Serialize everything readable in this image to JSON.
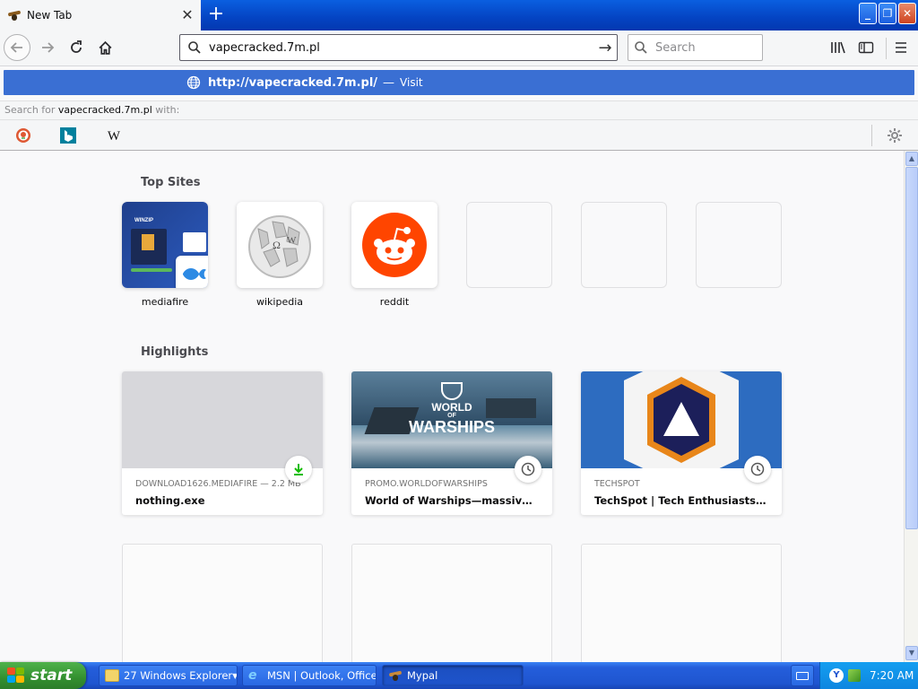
{
  "browser": {
    "tab_title": "New Tab",
    "url_value": "vapecracked.7m.pl",
    "search_placeholder": "Search"
  },
  "suggestion": {
    "url": "http://vapecracked.7m.pl/",
    "separator": "—",
    "action": "Visit"
  },
  "search_for": {
    "prefix": "Search for",
    "query": "vapecracked.7m.pl",
    "suffix": "with:"
  },
  "search_engines": [
    "duckduckgo-icon",
    "bing-icon",
    "wikipedia-icon"
  ],
  "top_sites": {
    "title": "Top Sites",
    "items": [
      {
        "label": "mediafire"
      },
      {
        "label": "wikipedia"
      },
      {
        "label": "reddit"
      },
      {
        "label": ""
      },
      {
        "label": ""
      },
      {
        "label": ""
      }
    ],
    "mediafire_preview_text": "WINZIP"
  },
  "highlights": {
    "title": "Highlights",
    "items": [
      {
        "source": "DOWNLOAD1626.MEDIAFIRE — 2.2 MB",
        "title": "nothing.exe",
        "badge": "download-icon"
      },
      {
        "source": "PROMO.WORLDOFWARSHIPS",
        "title": "World of Warships—massive naval battles",
        "badge": "clock-icon",
        "logo_line1": "WORLD",
        "logo_line2": "OF",
        "logo_line3": "WARSHIPS"
      },
      {
        "source": "TECHSPOT",
        "title": "TechSpot | Tech Enthusiasts, Power Users",
        "badge": "clock-icon"
      }
    ]
  },
  "taskbar": {
    "start_label": "start",
    "items": [
      {
        "label": "27 Windows Explorer"
      },
      {
        "label": "MSN | Outlook, Office..."
      },
      {
        "label": "Mypal"
      }
    ],
    "clock": "7:20 AM"
  },
  "colors": {
    "accent_blue": "#3a6fd3",
    "reddit_orange": "#ff4500",
    "techspot_blue": "#2d6cc0",
    "xp_start_green": "#338f2f"
  }
}
